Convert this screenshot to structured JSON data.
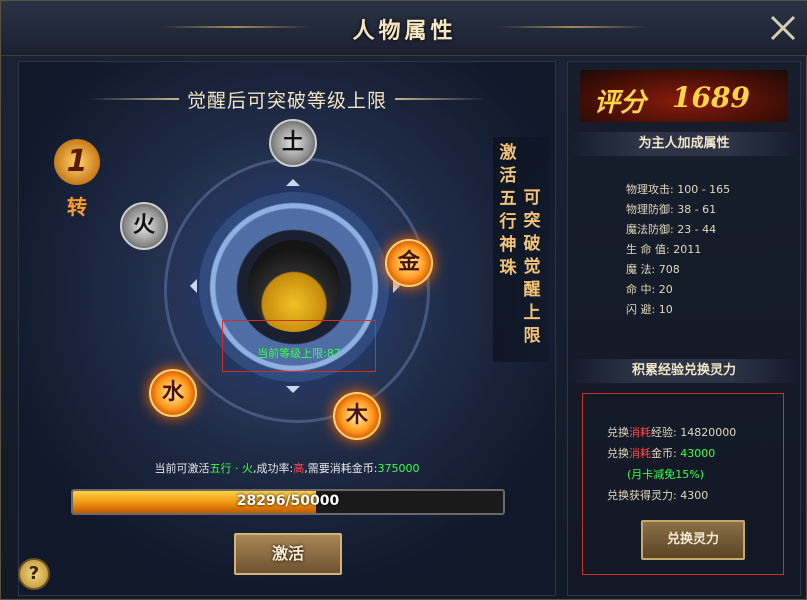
{
  "window": {
    "title": "人物属性"
  },
  "left": {
    "banner": "觉醒后可突破等级上限",
    "rebirth": {
      "number": "1",
      "label": "转"
    },
    "elements": {
      "tu": "土",
      "huo": "火",
      "jin": "金",
      "shui": "水",
      "mu": "木"
    },
    "level_text": "当前等级上限:87",
    "vertical_1": [
      "激",
      "活",
      "五",
      "行",
      "神",
      "珠"
    ],
    "vertical_2": [
      "可",
      "突",
      "破",
      "觉",
      "醒",
      "上",
      "限"
    ],
    "info": {
      "prefix": "当前可激活",
      "element": "五行 · 火",
      "mid": ",成功率:",
      "rate": "高",
      "suffix": ",需要消耗金币:",
      "gold": "375000"
    },
    "progress": {
      "text": "28296/50000",
      "current": 28296,
      "max": 50000
    },
    "activate_label": "激活",
    "help_label": "?"
  },
  "right": {
    "score_label": "评分",
    "score_value": "1689",
    "bonus_title": "为主人加成属性",
    "stats": [
      "物理攻击: 100 - 165",
      "物理防御: 38 - 61",
      "魔法防御: 23 - 44",
      "生 命 值: 2011",
      "魔    法: 708",
      "命    中: 20",
      "闪    避: 10"
    ],
    "exchange_title": "积累经验兑换灵力",
    "exchange": {
      "line1_a": "兑换",
      "line1_b": "消耗",
      "line1_c": "经验: 14820000",
      "line2_a": "兑换",
      "line2_b": "消耗",
      "line2_c": "金币: ",
      "line2_gold": "43000",
      "note": "(月卡减免15%)",
      "line3": "兑换获得灵力: 4300",
      "button": "兑换灵力"
    }
  },
  "colors": {
    "accent_red": "#c8322b",
    "green": "#3dff4b",
    "gold": "#ffd447"
  }
}
